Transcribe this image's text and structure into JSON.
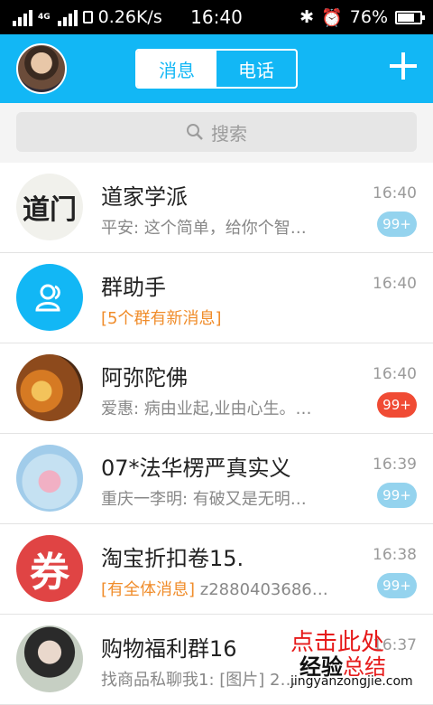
{
  "status_bar": {
    "network_type": "4G",
    "speed": "0.26K/s",
    "time": "16:40",
    "battery": "76%",
    "battery_level": 0.76
  },
  "header": {
    "tabs": [
      {
        "label": "消息",
        "active": true
      },
      {
        "label": "电话",
        "active": false
      }
    ],
    "accent_color": "#12b7f5"
  },
  "search": {
    "placeholder": "搜索"
  },
  "chats": [
    {
      "name": "道家学派",
      "avatar_text": "道门",
      "preview": "平安: 这个简单，给你个智…",
      "time": "16:40",
      "badge": "99+",
      "badge_color": "blue"
    },
    {
      "name": "群助手",
      "preview_tag": "[5个群有新消息]",
      "time": "16:40"
    },
    {
      "name": "阿弥陀佛",
      "preview": "爱惠: 病由业起,业由心生。…",
      "time": "16:40",
      "badge": "99+",
      "badge_color": "red"
    },
    {
      "name": "07*法华楞严真实义",
      "preview": "重庆一李明: 有破又是无明…",
      "time": "16:39",
      "badge": "99+",
      "badge_color": "blue"
    },
    {
      "name": "淘宝折扣卷15.",
      "avatar_text": "券",
      "preview_tag": "[有全体消息]",
      "preview": " z2880403686…",
      "time": "16:38",
      "badge": "99+",
      "badge_color": "blue"
    },
    {
      "name": "购物福利群16",
      "preview": "找商品私聊我1: [图片] 2…",
      "time": "16:37"
    }
  ],
  "watermark": {
    "line1": "点击此处",
    "line2a": "经验",
    "line2b": "总结",
    "url": "jingyanzongjie.com"
  }
}
